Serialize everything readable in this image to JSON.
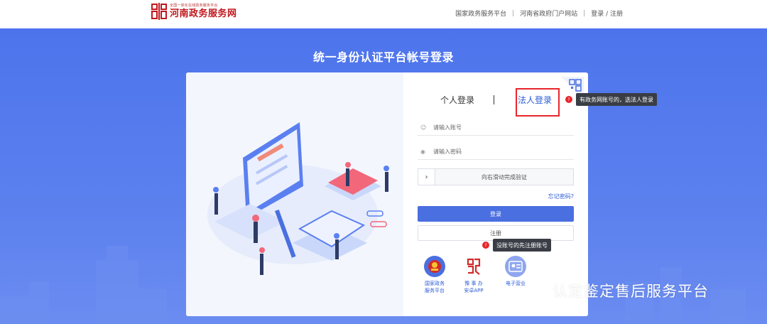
{
  "header": {
    "logo_small": "全国一体化在线政务服务平台",
    "logo_title": "河南政务服务网",
    "nav": [
      "国家政务服务平台",
      "河南省政府门户网站",
      "登录 / 注册"
    ]
  },
  "page_title": "统一身份认证平台帐号登录",
  "login": {
    "tabs": [
      "个人登录",
      "法人登录"
    ],
    "active_tab": "法人登录",
    "username_placeholder": "请输入账号",
    "password_placeholder": "请输入密码",
    "slider_text": "向右滑动完成验证",
    "forgot": "忘记密码?",
    "login_button": "登录",
    "register_button": "注册"
  },
  "quick_links": [
    {
      "label": "国家政务服务平台",
      "line1": "国家政务",
      "line2": "服务平台",
      "icon": "national-emblem-icon"
    },
    {
      "label": "豫事办安卓APP",
      "line1": "豫 事 办",
      "line2": "安卓APP",
      "icon": "yushiban-logo-icon"
    },
    {
      "label": "电子营业",
      "line1": "电子营业",
      "line2": "",
      "icon": "license-card-icon"
    }
  ],
  "tooltips": {
    "corp_hint": "有政务网账号的，选法人登录",
    "register_hint": "没账号的先注册账号",
    "badge": "?"
  },
  "watermark": "认定鉴定售后服务平台",
  "colors": {
    "brand_red": "#c0161d",
    "hero_blue": "#4d74ec",
    "primary": "#4a6fe0",
    "link": "#2a5bd7",
    "highlight": "#e8262c"
  }
}
